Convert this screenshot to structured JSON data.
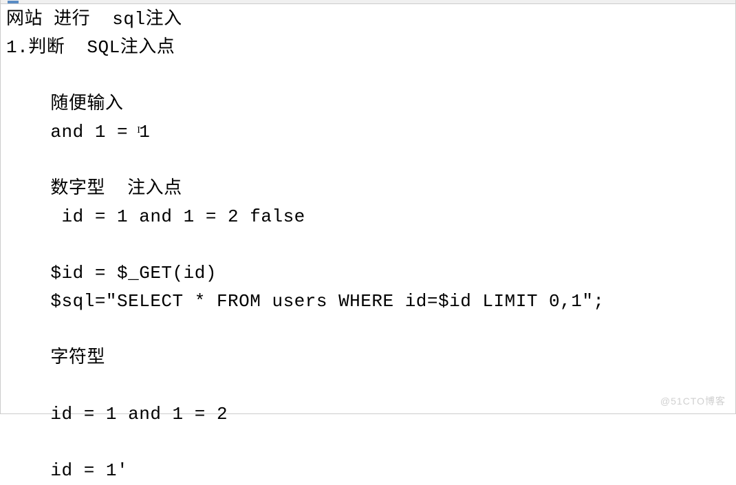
{
  "toolbar": {
    "filename_hint": ""
  },
  "doc": {
    "lines": [
      {
        "text": "网站 进行  sql注入",
        "indent": 0
      },
      {
        "text": "1.判断  SQL注入点",
        "indent": 0
      },
      {
        "text": "",
        "indent": 0
      },
      {
        "text": "随便输入",
        "indent": 1
      },
      {
        "text": "and 1 = ",
        "text2": "1",
        "cursor_between": true,
        "indent": 1
      },
      {
        "text": "",
        "indent": 0
      },
      {
        "text": "数字型  注入点",
        "indent": 1
      },
      {
        "text": " id = 1 and 1 = 2 false",
        "indent": 1
      },
      {
        "text": "",
        "indent": 0
      },
      {
        "text": "$id = $_GET(id)",
        "indent": 1
      },
      {
        "text": "$sql=\"SELECT * FROM users WHERE id=$id LIMIT 0,1\";",
        "indent": 1
      },
      {
        "text": "",
        "indent": 0
      },
      {
        "text": "字符型",
        "indent": 1
      },
      {
        "text": "",
        "indent": 0
      },
      {
        "text": "id = 1 and 1 = 2",
        "indent": 1
      },
      {
        "text": "",
        "indent": 0
      },
      {
        "text": "id = 1'",
        "indent": 1
      }
    ]
  },
  "watermark": "@51CTO博客"
}
